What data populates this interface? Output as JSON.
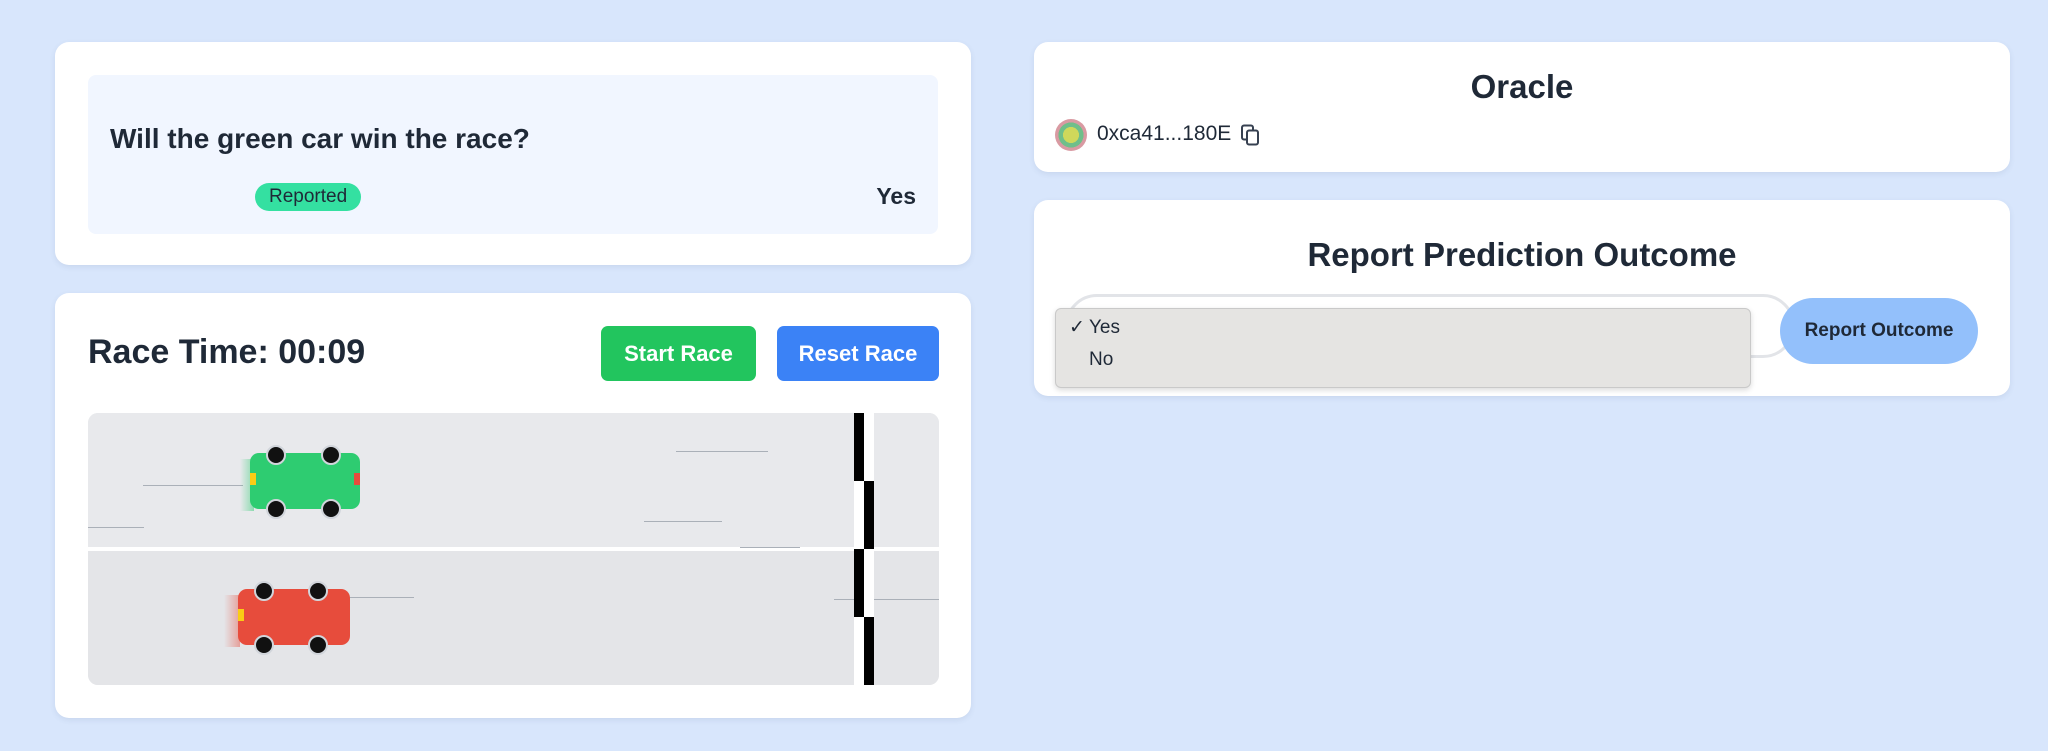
{
  "question": {
    "text": "Will the green car win the race?",
    "status": "Reported",
    "answer": "Yes"
  },
  "race": {
    "time_label": "Race Time: 00:09",
    "start_label": "Start Race",
    "reset_label": "Reset Race",
    "cars": [
      {
        "name": "green-car",
        "color": "#2ecc71",
        "lane": 1
      },
      {
        "name": "red-car",
        "color": "#e74c3c",
        "lane": 2
      }
    ]
  },
  "oracle": {
    "title": "Oracle",
    "address": "0xca41...180E",
    "copy_icon": "copy-icon"
  },
  "report": {
    "title": "Report Prediction Outcome",
    "options": [
      "Yes",
      "No"
    ],
    "selected": "Yes",
    "check_mark": "✓",
    "button_label": "Report Outcome"
  },
  "colors": {
    "background": "#d8e6fc",
    "start_button": "#22c55e",
    "reset_button": "#3b82f6",
    "report_button": "#93c0fb",
    "status_badge": "#34e0a1"
  }
}
